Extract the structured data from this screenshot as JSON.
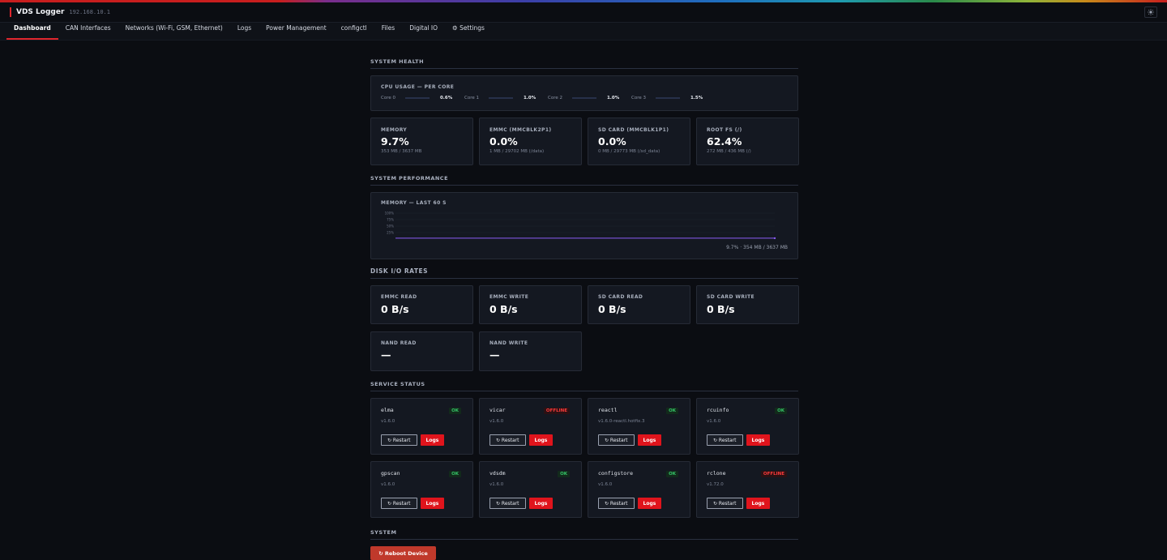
{
  "app": {
    "title": "VDS Logger",
    "ip": "192.168.10.1",
    "theme_icon": "sun-icon"
  },
  "tabs": [
    {
      "label": "Dashboard",
      "active": true
    },
    {
      "label": "CAN Interfaces"
    },
    {
      "label": "Networks (Wi-Fi, GSM, Ethernet)"
    },
    {
      "label": "Logs"
    },
    {
      "label": "Power Management"
    },
    {
      "label": "configctl"
    },
    {
      "label": "Files"
    },
    {
      "label": "Digital IO"
    },
    {
      "label": "⚙ Settings"
    }
  ],
  "health": {
    "title": "SYSTEM HEALTH",
    "cpu_title": "CPU USAGE — PER CORE",
    "cores": [
      {
        "label": "Core 0",
        "pct": "0.6%",
        "value": 0.006
      },
      {
        "label": "Core 1",
        "pct": "1.0%",
        "value": 0.01
      },
      {
        "label": "Core 2",
        "pct": "1.0%",
        "value": 0.01
      },
      {
        "label": "Core 3",
        "pct": "1.5%",
        "value": 0.015
      }
    ],
    "metrics": [
      {
        "label": "MEMORY",
        "value": "9.7%",
        "sub": "353 MB / 3637 MB"
      },
      {
        "label": "EMMC (MMCBLK2P1)",
        "value": "0.0%",
        "sub": "1 MB / 29702 MB (/data)"
      },
      {
        "label": "SD CARD (MMCBLK1P1)",
        "value": "0.0%",
        "sub": "0 MB / 29773 MB (/sd_data)"
      },
      {
        "label": "ROOT FS (/)",
        "value": "62.4%",
        "sub": "272 MB / 436 MB (/)"
      }
    ]
  },
  "performance": {
    "title": "SYSTEM PERFORMANCE",
    "chart_title": "MEMORY — LAST 60 S",
    "footer": "9.7% · 354 MB / 3637 MB",
    "chart_data": {
      "type": "line",
      "yticks": [
        "100%",
        "75%",
        "50%",
        "25%"
      ],
      "ylim": [
        0,
        100
      ],
      "series": [
        {
          "values": [
            9.7,
            9.7,
            9.7,
            9.7,
            9.7,
            9.7,
            9.7,
            9.7,
            9.7,
            9.7,
            9.7,
            9.7
          ]
        }
      ],
      "color": "#8b5cf6"
    }
  },
  "disk_io": {
    "title": "DISK I/O RATES",
    "items": [
      {
        "label": "EMMC READ",
        "value": "0 B/s"
      },
      {
        "label": "EMMC WRITE",
        "value": "0 B/s"
      },
      {
        "label": "SD CARD READ",
        "value": "0 B/s"
      },
      {
        "label": "SD CARD WRITE",
        "value": "0 B/s"
      },
      {
        "label": "NAND READ",
        "value": "—"
      },
      {
        "label": "NAND WRITE",
        "value": "—"
      }
    ]
  },
  "services": {
    "title": "SERVICE STATUS",
    "restart_label": "↻ Restart",
    "logs_label": "Logs",
    "items": [
      {
        "name": "elma",
        "version": "v1.6.0",
        "status": "OK"
      },
      {
        "name": "vicar",
        "version": "v1.6.0",
        "status": "OFFLINE"
      },
      {
        "name": "reactl",
        "version": "v1.6.0-reactl.hotfix.3",
        "status": "OK"
      },
      {
        "name": "rcuinfo",
        "version": "v1.6.0",
        "status": "OK"
      },
      {
        "name": "gpscan",
        "version": "v1.6.0",
        "status": "OK"
      },
      {
        "name": "vdsdm",
        "version": "v1.6.0",
        "status": "OK"
      },
      {
        "name": "configstore",
        "version": "v1.6.0",
        "status": "OK"
      },
      {
        "name": "rclone",
        "version": "v1.72.0",
        "status": "OFFLINE"
      }
    ]
  },
  "system": {
    "title": "SYSTEM",
    "reboot_label": "↻ Reboot Device"
  },
  "colors": {
    "accent": "#e0262d",
    "ok": "#35c267",
    "offline": "#ff3b3b",
    "chart_line": "#8b5cf6"
  }
}
